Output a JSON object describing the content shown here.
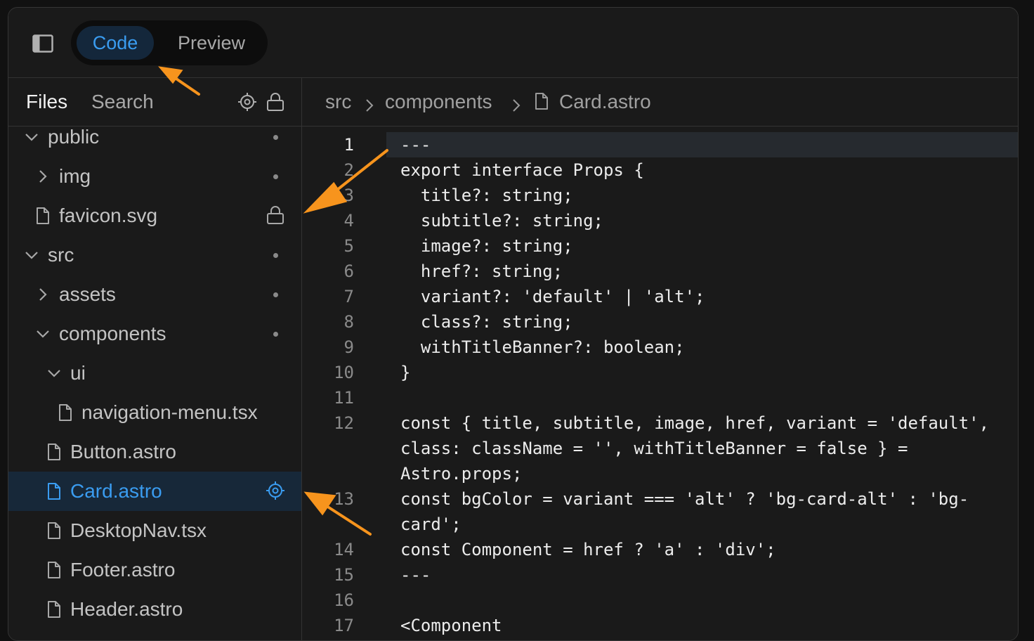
{
  "topbar": {
    "tabs": [
      {
        "label": "Code",
        "active": true
      },
      {
        "label": "Preview",
        "active": false
      }
    ]
  },
  "files_panel": {
    "tabs": {
      "files": "Files",
      "search": "Search"
    },
    "tree": [
      {
        "label": "public",
        "type": "folder",
        "expanded": true,
        "indent": 0,
        "marker": "dot"
      },
      {
        "label": "img",
        "type": "folder",
        "expanded": false,
        "indent": 1,
        "marker": "dot"
      },
      {
        "label": "favicon.svg",
        "type": "file",
        "indent": 1,
        "marker": "lock"
      },
      {
        "label": "src",
        "type": "folder",
        "expanded": true,
        "indent": 0,
        "marker": "dot"
      },
      {
        "label": "assets",
        "type": "folder",
        "expanded": false,
        "indent": 1,
        "marker": "dot"
      },
      {
        "label": "components",
        "type": "folder",
        "expanded": true,
        "indent": 1,
        "marker": "dot"
      },
      {
        "label": "ui",
        "type": "folder",
        "expanded": true,
        "indent": 2,
        "marker": ""
      },
      {
        "label": "navigation-menu.tsx",
        "type": "file",
        "indent": 3,
        "marker": ""
      },
      {
        "label": "Button.astro",
        "type": "file",
        "indent": 2,
        "marker": ""
      },
      {
        "label": "Card.astro",
        "type": "file",
        "indent": 2,
        "marker": "target",
        "selected": true
      },
      {
        "label": "DesktopNav.tsx",
        "type": "file",
        "indent": 2,
        "marker": ""
      },
      {
        "label": "Footer.astro",
        "type": "file",
        "indent": 2,
        "marker": ""
      },
      {
        "label": "Header.astro",
        "type": "file",
        "indent": 2,
        "marker": ""
      }
    ]
  },
  "editor": {
    "breadcrumb": [
      "src",
      "components",
      "Card.astro"
    ],
    "active_line": "1",
    "lines": [
      {
        "n": "1",
        "text": "---"
      },
      {
        "n": "2",
        "text": "export interface Props {"
      },
      {
        "n": "3",
        "text": "  title?: string;"
      },
      {
        "n": "4",
        "text": "  subtitle?: string;"
      },
      {
        "n": "5",
        "text": "  image?: string;"
      },
      {
        "n": "6",
        "text": "  href?: string;"
      },
      {
        "n": "7",
        "text": "  variant?: 'default' | 'alt';"
      },
      {
        "n": "8",
        "text": "  class?: string;"
      },
      {
        "n": "9",
        "text": "  withTitleBanner?: boolean;"
      },
      {
        "n": "10",
        "text": "}"
      },
      {
        "n": "11",
        "text": ""
      },
      {
        "n": "12",
        "text": "const { title, subtitle, image, href, variant = 'default',"
      },
      {
        "n": "",
        "text": "class: className = '', withTitleBanner = false } ="
      },
      {
        "n": "",
        "text": "Astro.props;"
      },
      {
        "n": "13",
        "text": "const bgColor = variant === 'alt' ? 'bg-card-alt' : 'bg-"
      },
      {
        "n": "",
        "text": "card';"
      },
      {
        "n": "14",
        "text": "const Component = href ? 'a' : 'div';"
      },
      {
        "n": "15",
        "text": "---"
      },
      {
        "n": "16",
        "text": ""
      },
      {
        "n": "17",
        "text": "<Component"
      }
    ]
  },
  "colors": {
    "accent": "#3a9cf0",
    "annotation_arrow": "#f7941d",
    "selected_row_bg": "#172839"
  }
}
